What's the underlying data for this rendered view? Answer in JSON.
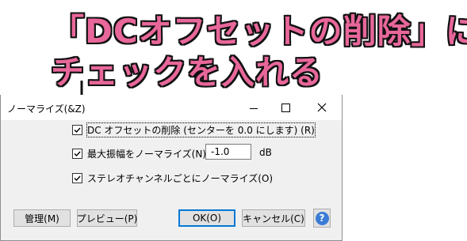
{
  "annotation": {
    "line1": "「DCオフセットの削除」に",
    "line2": "チェックを入れる"
  },
  "dialog": {
    "title": "ノーマライズ(&Z)",
    "options": [
      {
        "label": "DC オフセットの削除 (センターを 0.0 にします) (R)",
        "checked": true
      },
      {
        "label": "最大振幅をノーマライズ(N):",
        "checked": true
      },
      {
        "label": "ステレオチャンネルごとにノーマライズ(O)",
        "checked": true
      }
    ],
    "amplitude_value": "-1.0",
    "amplitude_unit": "dB",
    "buttons": {
      "manage": "管理(M)",
      "preview": "プレビュー(P)",
      "ok": "OK(O)",
      "cancel": "キャンセル(C)",
      "help": "?"
    }
  },
  "colors": {
    "annotation_fill": "#e8679a",
    "annotation_outline": "#111111",
    "accent": "#0078d7",
    "help_icon": "#3a7bd5"
  },
  "icons": [
    "down-arrow-icon",
    "minimize-icon",
    "maximize-icon",
    "close-icon",
    "checkbox-check-icon",
    "help-icon"
  ]
}
